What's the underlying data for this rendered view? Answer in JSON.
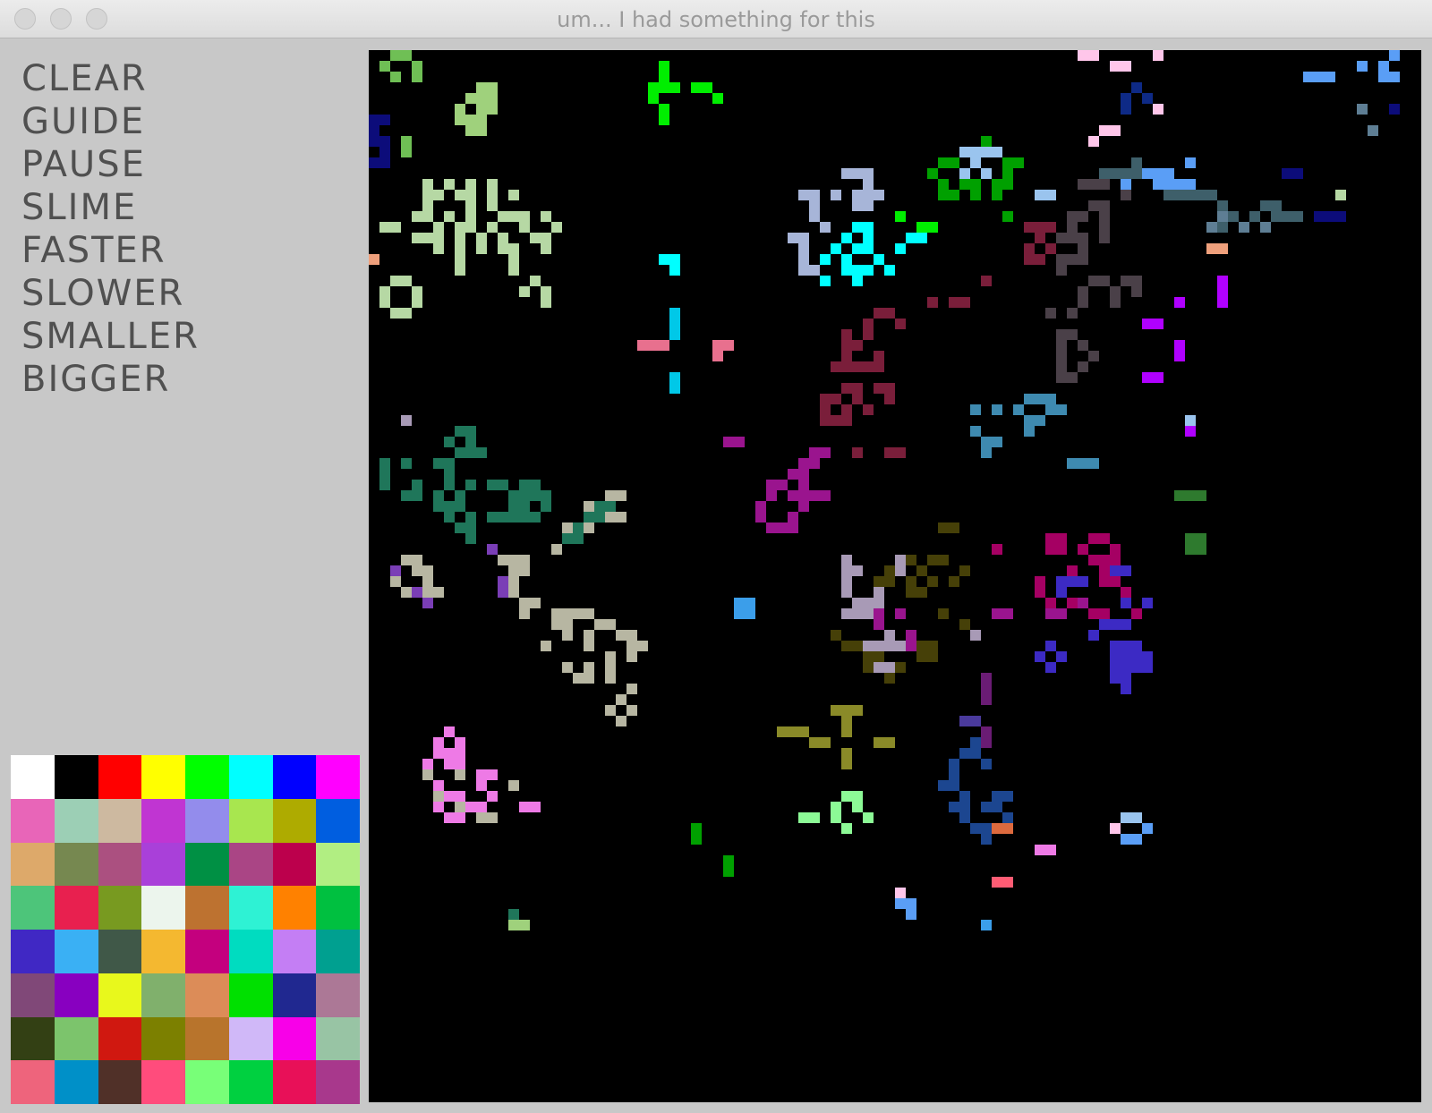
{
  "window": {
    "title": "um... I had something for this"
  },
  "menu": {
    "items": [
      {
        "label": "CLEAR"
      },
      {
        "label": "GUIDE"
      },
      {
        "label": "PAUSE"
      },
      {
        "label": "SLIME"
      },
      {
        "label": "FASTER"
      },
      {
        "label": "SLOWER"
      },
      {
        "label": "SMALLER"
      },
      {
        "label": "BIGGER"
      }
    ]
  },
  "palette": {
    "colors": [
      "#ffffff",
      "#000000",
      "#ff0000",
      "#ffff00",
      "#00ff00",
      "#00ffff",
      "#0000ff",
      "#ff00ff",
      "#e865b8",
      "#9ccfb5",
      "#cdb9a0",
      "#c035d2",
      "#938cec",
      "#a8e64f",
      "#aeab00",
      "#005ee0",
      "#dda96a",
      "#768850",
      "#ab5080",
      "#a940d9",
      "#009044",
      "#aa4585",
      "#bc004c",
      "#b1ee82",
      "#4dc57a",
      "#e8204f",
      "#789a20",
      "#ecf5ed",
      "#bd7230",
      "#2ef2d4",
      "#ff8100",
      "#00c040",
      "#4028c4",
      "#3ab0f4",
      "#405848",
      "#f4b830",
      "#c4007e",
      "#00dcc0",
      "#c47ef4",
      "#00a090",
      "#804878",
      "#8800c0",
      "#e8f81c",
      "#80b06c",
      "#dc8c58",
      "#00e000",
      "#202890",
      "#ac7896",
      "#334014",
      "#7cc46c",
      "#d01810",
      "#7c8000",
      "#b8742c",
      "#d0b8f8",
      "#f800e8",
      "#98c4a4",
      "#ee647c",
      "#0090c8",
      "#503028",
      "#ff4c7c",
      "#78ff78",
      "#00d040",
      "#e81058",
      "#a8388c"
    ]
  },
  "board": {
    "background": "#000000",
    "cell_colors": {
      "a": "#6fbf55",
      "b": "#9fd17c",
      "c": "#b6d8a4",
      "d": "#0c0c7a",
      "e": "#00ee00",
      "f": "#ffc6ea",
      "g": "#0e2a86",
      "h": "#5a9ef6",
      "i": "#3e5f6a",
      "j": "#00c8e8",
      "k": "#a7b5d8",
      "l": "#00ffff",
      "m": "#e8708e",
      "n": "#00a000",
      "o": "#9ac4ee",
      "p": "#7a1e3a",
      "q": "#4a4048",
      "r": "#5e7e94",
      "s": "#b000ff",
      "t": "#9a148e",
      "u": "#1f765a",
      "v": "#b7b6a2",
      "w": "#7a3eb6",
      "x": "#464008",
      "y": "#a89ab6",
      "z": "#4a3a9c",
      "A": "#3c2ac4",
      "B": "#a50063",
      "C": "#6a1c74",
      "D": "#ee7ae6",
      "E": "#8a8a28",
      "F": "#8cfa96",
      "G": "#dd6a3e",
      "H": "#1c4690",
      "I": "#2e7a2e",
      "J": "#ff5c74",
      "K": "#3b9eea",
      "L": "#3e8ab0",
      "M": "#efa07c"
    }
  }
}
